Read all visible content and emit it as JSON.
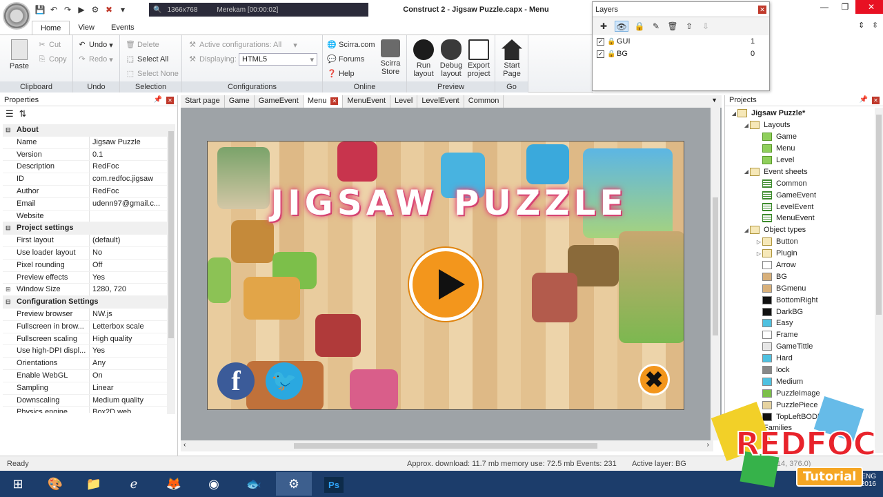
{
  "window": {
    "title": "Construct 2 - Jigsaw Puzzle.capx - Menu"
  },
  "quick_access": {
    "preview_res": "1366x768",
    "recording": "Merekam [00:00:02]"
  },
  "ribbon": {
    "tabs": [
      "Home",
      "View",
      "Events"
    ],
    "clipboard": {
      "paste": "Paste",
      "cut": "Cut",
      "copy": "Copy",
      "label": "Clipboard"
    },
    "undo": {
      "undo": "Undo",
      "redo": "Redo",
      "label": "Undo"
    },
    "selection": {
      "delete": "Delete",
      "select_all": "Select All",
      "select_none": "Select None",
      "label": "Selection"
    },
    "configurations": {
      "active": "Active configurations: All",
      "displaying_label": "Displaying:",
      "displaying_value": "HTML5",
      "label": "Configurations"
    },
    "online": {
      "scirra": "Scirra.com",
      "forums": "Forums",
      "help": "Help",
      "store_line1": "Scirra",
      "store_line2": "Store",
      "label": "Online"
    },
    "preview": {
      "run_1": "Run",
      "run_2": "layout",
      "debug_1": "Debug",
      "debug_2": "layout",
      "export_1": "Export",
      "export_2": "project",
      "label": "Preview"
    },
    "go": {
      "start_1": "Start",
      "start_2": "Page",
      "label": "Go"
    }
  },
  "layers": {
    "title": "Layers",
    "items": [
      {
        "name": "GUI",
        "index": "1"
      },
      {
        "name": "BG",
        "index": "0"
      }
    ]
  },
  "properties": {
    "title": "Properties",
    "rows": [
      {
        "type": "cat",
        "key": "About"
      },
      {
        "key": "Name",
        "value": "Jigsaw Puzzle"
      },
      {
        "key": "Version",
        "value": "0.1"
      },
      {
        "key": "Description",
        "value": "RedFoc"
      },
      {
        "key": "ID",
        "value": "com.redfoc.jigsaw"
      },
      {
        "key": "Author",
        "value": "RedFoc"
      },
      {
        "key": "Email",
        "value": "udenn97@gmail.c..."
      },
      {
        "key": "Website",
        "value": ""
      },
      {
        "type": "cat",
        "key": "Project settings"
      },
      {
        "key": "First layout",
        "value": "(default)"
      },
      {
        "key": "Use loader layout",
        "value": "No"
      },
      {
        "key": "Pixel rounding",
        "value": "Off"
      },
      {
        "key": "Preview effects",
        "value": "Yes"
      },
      {
        "key": "Window Size",
        "value": "1280, 720",
        "expand": true
      },
      {
        "type": "cat",
        "key": "Configuration Settings"
      },
      {
        "key": "Preview browser",
        "value": "NW.js"
      },
      {
        "key": "Fullscreen in brow...",
        "value": "Letterbox scale"
      },
      {
        "key": "Fullscreen scaling",
        "value": "High quality"
      },
      {
        "key": "Use high-DPI displ...",
        "value": "Yes"
      },
      {
        "key": "Orientations",
        "value": "Any"
      },
      {
        "key": "Enable WebGL",
        "value": "On"
      },
      {
        "key": "Sampling",
        "value": "Linear"
      },
      {
        "key": "Downscaling",
        "value": "Medium quality"
      },
      {
        "key": "Physics engine",
        "value": "Box2D web"
      }
    ]
  },
  "editor_tabs": [
    "Start page",
    "Game",
    "GameEvent",
    "Menu",
    "MenuEvent",
    "Level",
    "LevelEvent",
    "Common"
  ],
  "canvas": {
    "title": "JIGSAW PUZZLE",
    "fb": "f",
    "tw": "🐦",
    "close": "✖"
  },
  "projects": {
    "title": "Projects",
    "tree": [
      {
        "label": "Jigsaw Puzzle*",
        "level": 0,
        "icon": "folder",
        "bold": true,
        "tw": "◢"
      },
      {
        "label": "Layouts",
        "level": 1,
        "icon": "folder",
        "tw": "◢"
      },
      {
        "label": "Game",
        "level": 2,
        "icon": "layout"
      },
      {
        "label": "Menu",
        "level": 2,
        "icon": "layout"
      },
      {
        "label": "Level",
        "level": 2,
        "icon": "layout"
      },
      {
        "label": "Event sheets",
        "level": 1,
        "icon": "folder",
        "tw": "◢"
      },
      {
        "label": "Common",
        "level": 2,
        "icon": "sheet"
      },
      {
        "label": "GameEvent",
        "level": 2,
        "icon": "sheet"
      },
      {
        "label": "LevelEvent",
        "level": 2,
        "icon": "sheet"
      },
      {
        "label": "MenuEvent",
        "level": 2,
        "icon": "sheet"
      },
      {
        "label": "Object types",
        "level": 1,
        "icon": "folder",
        "tw": "◢"
      },
      {
        "label": "Button",
        "level": 2,
        "icon": "folder",
        "tw": "▷"
      },
      {
        "label": "Plugin",
        "level": 2,
        "icon": "folder",
        "tw": "▷"
      },
      {
        "label": "Arrow",
        "level": 2,
        "icon": "obj",
        "color": "#ffffff"
      },
      {
        "label": "BG",
        "level": 2,
        "icon": "obj",
        "color": "#d8b07a"
      },
      {
        "label": "BGmenu",
        "level": 2,
        "icon": "obj",
        "color": "#d8b07a"
      },
      {
        "label": "BottomRight",
        "level": 2,
        "icon": "obj",
        "color": "#111111"
      },
      {
        "label": "DarkBG",
        "level": 2,
        "icon": "obj",
        "color": "#111111"
      },
      {
        "label": "Easy",
        "level": 2,
        "icon": "obj",
        "color": "#4fc1e0"
      },
      {
        "label": "Frame",
        "level": 2,
        "icon": "obj",
        "color": "#ffffff"
      },
      {
        "label": "GameTittle",
        "level": 2,
        "icon": "obj",
        "color": "#e6e6e6"
      },
      {
        "label": "Hard",
        "level": 2,
        "icon": "obj",
        "color": "#4fc1e0"
      },
      {
        "label": "lock",
        "level": 2,
        "icon": "obj",
        "color": "#888888"
      },
      {
        "label": "Medium",
        "level": 2,
        "icon": "obj",
        "color": "#4fc1e0"
      },
      {
        "label": "PuzzleImage",
        "level": 2,
        "icon": "obj",
        "color": "#7cbf4a"
      },
      {
        "label": "PuzzlePiece",
        "level": 2,
        "icon": "obj",
        "color": "#e6d3a0"
      },
      {
        "label": "TopLeftBODER",
        "level": 2,
        "icon": "obj",
        "color": "#111111"
      },
      {
        "label": "Families",
        "level": 1,
        "icon": "folder",
        "tw": "▷"
      }
    ]
  },
  "status": {
    "ready": "Ready",
    "info": "Approx. download: 11.7 mb   memory use: 72.5 mb   Events: 231",
    "layer": "Active layer: BG",
    "coords": "(1214, 376.0)"
  },
  "taskbar": {
    "lang": "ENG",
    "date": "8/1/2016"
  },
  "watermark": {
    "brand": "REDFOC",
    "sub": "Tutorial"
  }
}
